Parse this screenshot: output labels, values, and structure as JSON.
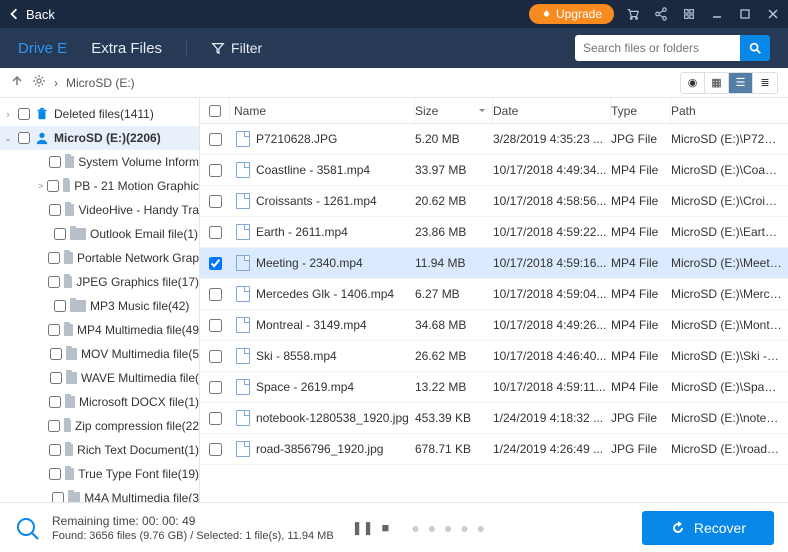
{
  "titlebar": {
    "back": "Back",
    "upgrade": "Upgrade"
  },
  "tabs": {
    "driveE": "Drive E",
    "extraFiles": "Extra Files",
    "filter": "Filter"
  },
  "search": {
    "placeholder": "Search files or folders"
  },
  "breadcrumb": {
    "path": "MicroSD (E:)"
  },
  "sidebar": {
    "deleted": "Deleted files(1411)",
    "root": "MicroSD (E:)(2206)",
    "items": [
      {
        "label": "System Volume Inform",
        "level": 2,
        "twisty": ""
      },
      {
        "label": "PB - 21 Motion Graphic",
        "level": 2,
        "twisty": ">"
      },
      {
        "label": "VideoHive - Handy Tra",
        "level": 2,
        "twisty": ""
      },
      {
        "label": "Outlook Email file(1)",
        "level": 2,
        "twisty": ""
      },
      {
        "label": "Portable Network Grap",
        "level": 2,
        "twisty": ""
      },
      {
        "label": "JPEG Graphics file(17)",
        "level": 2,
        "twisty": ""
      },
      {
        "label": "MP3 Music file(42)",
        "level": 2,
        "twisty": ""
      },
      {
        "label": "MP4 Multimedia file(49",
        "level": 2,
        "twisty": ""
      },
      {
        "label": "MOV Multimedia file(5",
        "level": 2,
        "twisty": ""
      },
      {
        "label": "WAVE Multimedia file(",
        "level": 2,
        "twisty": ""
      },
      {
        "label": "Microsoft DOCX file(1)",
        "level": 2,
        "twisty": ""
      },
      {
        "label": "Zip compression file(22",
        "level": 2,
        "twisty": ""
      },
      {
        "label": "Rich Text Document(1)",
        "level": 2,
        "twisty": ""
      },
      {
        "label": "True Type Font file(19)",
        "level": 2,
        "twisty": ""
      },
      {
        "label": "M4A Multimedia file(3",
        "level": 2,
        "twisty": ""
      }
    ]
  },
  "columns": {
    "name": "Name",
    "size": "Size",
    "date": "Date",
    "type": "Type",
    "path": "Path"
  },
  "rows": [
    {
      "name": "P7210628.JPG",
      "size": "5.20 MB",
      "date": "3/28/2019 4:35:23 ...",
      "type": "JPG File",
      "path": "MicroSD (E:)\\P7210...",
      "checked": false,
      "selected": false
    },
    {
      "name": "Coastline - 3581.mp4",
      "size": "33.97 MB",
      "date": "10/17/2018 4:49:34...",
      "type": "MP4 File",
      "path": "MicroSD (E:)\\Coastli...",
      "checked": false,
      "selected": false
    },
    {
      "name": "Croissants - 1261.mp4",
      "size": "20.62 MB",
      "date": "10/17/2018 4:58:56...",
      "type": "MP4 File",
      "path": "MicroSD (E:)\\Croiss...",
      "checked": false,
      "selected": false
    },
    {
      "name": "Earth - 2611.mp4",
      "size": "23.86 MB",
      "date": "10/17/2018 4:59:22...",
      "type": "MP4 File",
      "path": "MicroSD (E:)\\Earth -...",
      "checked": false,
      "selected": false
    },
    {
      "name": "Meeting - 2340.mp4",
      "size": "11.94 MB",
      "date": "10/17/2018 4:59:16...",
      "type": "MP4 File",
      "path": "MicroSD (E:)\\Meetin...",
      "checked": true,
      "selected": true
    },
    {
      "name": "Mercedes Glk - 1406.mp4",
      "size": "6.27 MB",
      "date": "10/17/2018 4:59:04...",
      "type": "MP4 File",
      "path": "MicroSD (E:)\\Merce...",
      "checked": false,
      "selected": false
    },
    {
      "name": "Montreal - 3149.mp4",
      "size": "34.68 MB",
      "date": "10/17/2018 4:49:26...",
      "type": "MP4 File",
      "path": "MicroSD (E:)\\Montr...",
      "checked": false,
      "selected": false
    },
    {
      "name": "Ski - 8558.mp4",
      "size": "26.62 MB",
      "date": "10/17/2018 4:46:40...",
      "type": "MP4 File",
      "path": "MicroSD (E:)\\Ski - 8...",
      "checked": false,
      "selected": false
    },
    {
      "name": "Space - 2619.mp4",
      "size": "13.22 MB",
      "date": "10/17/2018 4:59:11...",
      "type": "MP4 File",
      "path": "MicroSD (E:)\\Space ...",
      "checked": false,
      "selected": false
    },
    {
      "name": "notebook-1280538_1920.jpg",
      "size": "453.39 KB",
      "date": "1/24/2019 4:18:32 ...",
      "type": "JPG File",
      "path": "MicroSD (E:)\\noteb...",
      "checked": false,
      "selected": false
    },
    {
      "name": "road-3856796_1920.jpg",
      "size": "678.71 KB",
      "date": "1/24/2019 4:26:49 ...",
      "type": "JPG File",
      "path": "MicroSD (E:)\\road-3...",
      "checked": false,
      "selected": false
    }
  ],
  "footer": {
    "line1": "Remaining time: 00: 00: 49",
    "line2": "Found: 3656 files (9.76 GB)  /  Selected: 1 file(s), 11.94 MB",
    "recover": "Recover"
  }
}
